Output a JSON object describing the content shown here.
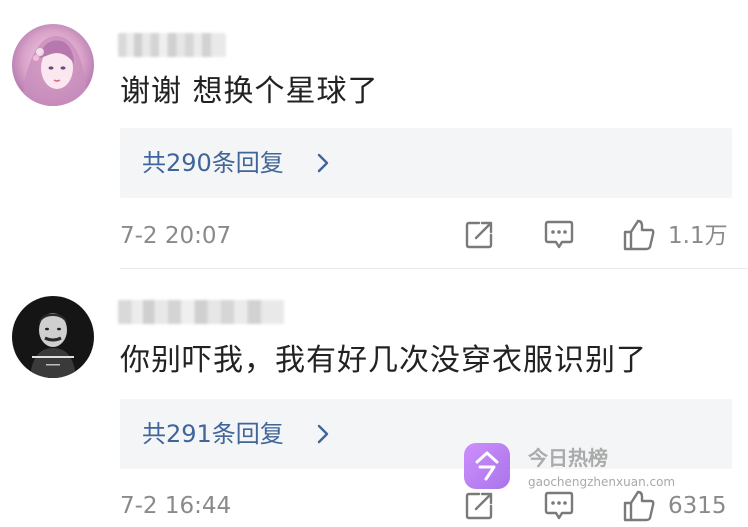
{
  "comments": [
    {
      "username": "",
      "text": "谢谢 想换个星球了",
      "reply_label": "共290条回复",
      "timestamp": "7-2 20:07",
      "like_count": "1.1万"
    },
    {
      "username": "",
      "text": "你别吓我，我有好几次没穿衣服识别了",
      "reply_label": "共291条回复",
      "timestamp": "7-2 16:44",
      "like_count": "6315"
    }
  ],
  "icons": {
    "share": "share-icon",
    "comment": "comment-icon",
    "like": "thumbs-up-icon",
    "chevron": "chevron-right-icon"
  },
  "colors": {
    "reply_link": "#406599",
    "meta_gray": "#8a8a8a",
    "reply_bg": "#f4f5f7"
  },
  "watermark": {
    "title": "今日热榜",
    "url": "gaochengzhenxuan.com"
  }
}
